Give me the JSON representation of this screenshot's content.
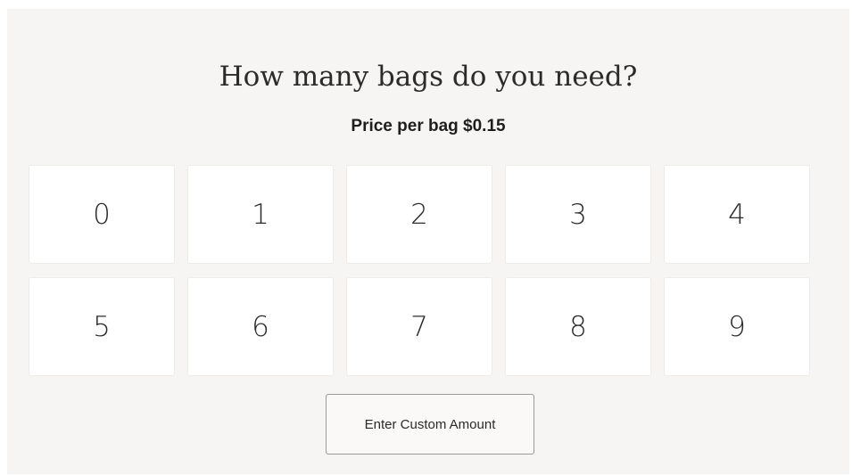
{
  "header": {
    "title": "How many bags do you need?",
    "price_label": "Price per bag $0.15"
  },
  "keypad": {
    "keys": [
      "0",
      "1",
      "2",
      "3",
      "4",
      "5",
      "6",
      "7",
      "8",
      "9"
    ]
  },
  "actions": {
    "custom_amount_label": "Enter Custom Amount"
  },
  "colors": {
    "background": "#f6f5f3",
    "key_background": "#ffffff",
    "text": "#2b2b2b"
  }
}
